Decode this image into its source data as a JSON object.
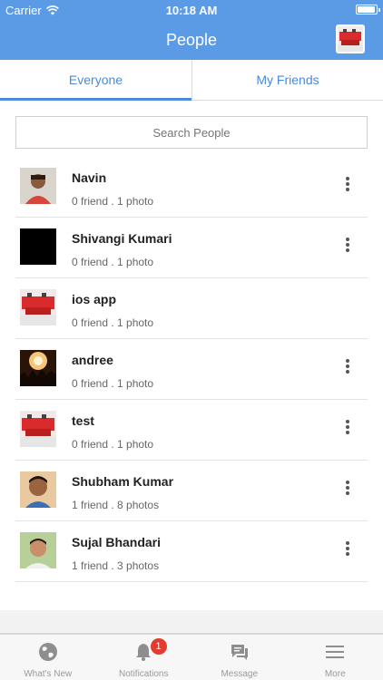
{
  "status_bar": {
    "carrier": "Carrier",
    "time": "10:18 AM"
  },
  "nav": {
    "title": "People",
    "avatar_icon": "user-photo-icon"
  },
  "tabs": [
    {
      "label": "Everyone",
      "active": true
    },
    {
      "label": "My Friends",
      "active": false
    }
  ],
  "search": {
    "placeholder": "Search People"
  },
  "people": [
    {
      "name": "Navin",
      "meta": "0 friend . 1 photo",
      "has_menu": true
    },
    {
      "name": "Shivangi Kumari",
      "meta": "0 friend . 1 photo",
      "has_menu": true
    },
    {
      "name": "ios app",
      "meta": "0 friend . 1 photo",
      "has_menu": false
    },
    {
      "name": "andree",
      "meta": "0 friend . 1 photo",
      "has_menu": true
    },
    {
      "name": "test",
      "meta": "0 friend . 1 photo",
      "has_menu": true
    },
    {
      "name": "Shubham Kumar",
      "meta": "1 friend . 8 photos",
      "has_menu": true
    },
    {
      "name": "Sujal Bhandari",
      "meta": "1 friend . 3 photos",
      "has_menu": true
    }
  ],
  "tabbar": [
    {
      "label": "What's New",
      "icon": "globe-icon"
    },
    {
      "label": "Notifications",
      "icon": "bell-icon",
      "badge": "1"
    },
    {
      "label": "Message",
      "icon": "chat-icon"
    },
    {
      "label": "More",
      "icon": "menu-icon"
    }
  ],
  "colors": {
    "primary": "#5b9be6",
    "tab_text": "#4a8ad8",
    "badge": "#e33b2e"
  }
}
